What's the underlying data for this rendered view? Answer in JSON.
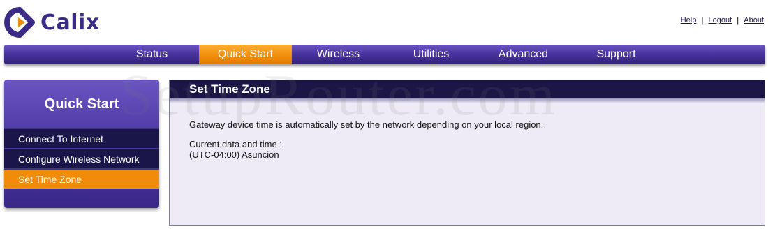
{
  "brand": {
    "name": "Calix"
  },
  "top_links": [
    "Help",
    "Logout",
    "About"
  ],
  "nav": {
    "items": [
      "Status",
      "Quick Start",
      "Wireless",
      "Utilities",
      "Advanced",
      "Support"
    ],
    "active": "Quick Start"
  },
  "sidebar": {
    "title": "Quick Start",
    "items": [
      "Connect To Internet",
      "Configure Wireless Network",
      "Set Time Zone"
    ],
    "active": "Set Time Zone"
  },
  "content": {
    "title": "Set Time Zone",
    "description": "Gateway device time is automatically set by the network depending on your local region.",
    "current_label": "Current data and time :",
    "current_value": "(UTC-04:00) Asuncion"
  },
  "watermark": "SetupRouter.com",
  "colors": {
    "nav_purple": "#4a35a0",
    "active_orange": "#f08c0a",
    "header_navy": "#1c1647",
    "content_bg": "#eeebf6",
    "brand_purple": "#3b2b86"
  }
}
